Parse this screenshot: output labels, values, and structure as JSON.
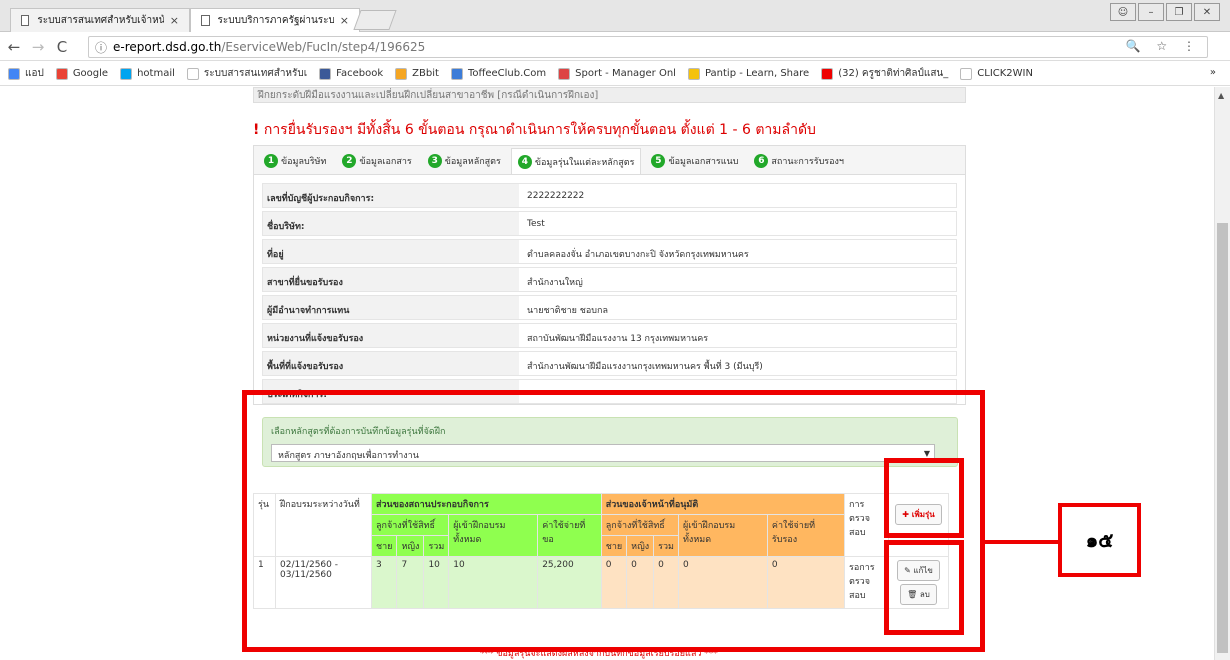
{
  "browser": {
    "tabs": [
      {
        "title": "ระบบสารสนเทศสำหรับเจ้าหน้",
        "close": "×"
      },
      {
        "title": "ระบบบริการภาครัฐผ่านระบบ",
        "close": "×"
      }
    ],
    "url_host": "e-report.dsd.go.th",
    "url_path": "/EserviceWeb/FucIn/step4/196625",
    "url_right_icons": "🔍 ☆ ⋮",
    "bookmarks": [
      {
        "label": "แอป",
        "color": "#4285f4"
      },
      {
        "label": "Google",
        "color": "#ea4335"
      },
      {
        "label": "hotmail",
        "color": "#00a4ef"
      },
      {
        "label": "ระบบสารสนเทศสำหรับเ",
        "color": "#ffffff"
      },
      {
        "label": "Facebook",
        "color": "#3b5998"
      },
      {
        "label": "ZBbit",
        "color": "#f5a623"
      },
      {
        "label": "ToffeeClub.Com",
        "color": "#3c7cd8"
      },
      {
        "label": "Sport - Manager Onl",
        "color": "#d44"
      },
      {
        "label": "Pantip - Learn, Share",
        "color": "#f4c20d"
      },
      {
        "label": "(32) ครูชาติท่าศิลป์แสน_",
        "color": "#e00"
      },
      {
        "label": "CLICK2WIN",
        "color": "#ffffff"
      }
    ],
    "bookmarks_more": "»"
  },
  "page": {
    "top_partial": "ฝึกยกระดับฝีมือแรงงานและเปลี่ยนฝีกเปลี่ยนสาขาอาชีพ [กรณีดำเนินการฝึกเอง]",
    "warning_mark": "!",
    "warning": "การยื่นรับรองฯ มีทั้งสิ้น 6 ขั้นตอน กรุณาดำเนินการให้ครบทุกขั้นตอน ตั้งแต่ 1 - 6 ตามลำดับ",
    "steps": [
      {
        "n": "1",
        "label": "ข้อมูลบริษัท"
      },
      {
        "n": "2",
        "label": "ข้อมูลเอกสาร"
      },
      {
        "n": "3",
        "label": "ข้อมูลหลักสูตร"
      },
      {
        "n": "4",
        "label": "ข้อมูลรุ่นในแต่ละหลักสูตร"
      },
      {
        "n": "5",
        "label": "ข้อมูลเอกสารแนบ"
      },
      {
        "n": "6",
        "label": "สถานะการรับรองฯ"
      }
    ],
    "info": [
      {
        "k": "เลขที่บัญชีผู้ประกอบกิจการ:",
        "v": "2222222222"
      },
      {
        "k": "ชื่อบริษัท:",
        "v": "Test"
      },
      {
        "k": "ที่อยู่",
        "v": "ตำบลคลองจั่น อำเภอเขตบางกะปิ จังหวัดกรุงเทพมหานคร"
      },
      {
        "k": "สาขาที่ยื่นขอรับรอง",
        "v": "สำนักงานใหญ่"
      },
      {
        "k": "ผู้มีอำนาจทำการแทน",
        "v": "นายชาติชาย ชอบกล"
      },
      {
        "k": "หน่วยงานที่แจ้งขอรับรอง",
        "v": "สถาบันพัฒนาฝีมือแรงงาน 13 กรุงเทพมหานคร"
      },
      {
        "k": "พื้นที่ที่แจ้งขอรับรอง",
        "v": "สำนักงานพัฒนาฝีมือแรงงานกรุงเทพมหานคร พื้นที่ 3 (มีนบุรี)"
      },
      {
        "k": "ประเภทกิจการ:",
        "v": ""
      }
    ],
    "select_label": "เลือกหลักสูตรที่ต้องการบันทึกข้อมูลรุ่นที่จัดฝึก",
    "select_value": "หลักสูตร ภาษาอังกฤษเพื่อการทำงาน",
    "select_arrow": "▼",
    "table": {
      "h_run": "รุ่น",
      "h_period": "ฝึกอบรมระหว่างวันที่",
      "h_company": "ส่วนของสถานประกอบกิจการ",
      "h_officer": "ส่วนของเจ้าหน้าที่อนุมัติ",
      "h_check": "การตรวจสอบ",
      "h_employees": "ลูกจ้างที่ใช้สิทธิ์",
      "h_trainees": "ผู้เข้าฝึกอบรมทั้งหมด",
      "h_cost": "ค่าใช้จ่ายที่ขอ",
      "h_employees2": "ลูกจ้างที่ใช้สิทธิ์",
      "h_trainees2": "ผู้เข้าฝึกอบรมทั้งหมด",
      "h_cost2": "ค่าใช้จ่ายที่รับรอง",
      "h_m": "ชาย",
      "h_f": "หญิง",
      "h_t": "รวม",
      "add_btn": "✚ เพิ่มรุ่น",
      "rows": [
        {
          "run": "1",
          "period": "02/11/2560 - 03/11/2560",
          "m": "3",
          "f": "7",
          "t": "10",
          "trainees": "10",
          "cost": "25,200",
          "m2": "0",
          "f2": "0",
          "t2": "0",
          "trainees2": "0",
          "cost2": "0",
          "status": "รอการตรวจสอบ",
          "edit": "✎ แก้ไข",
          "del": "🗑 ลบ"
        }
      ]
    },
    "footnote": "*** ข้อมูลรุ่นจะแสดงผลหลังจากบันทึกข้อมูลเรียบร้อยแล้ว ***"
  },
  "annotation": {
    "label": "๑๕"
  }
}
